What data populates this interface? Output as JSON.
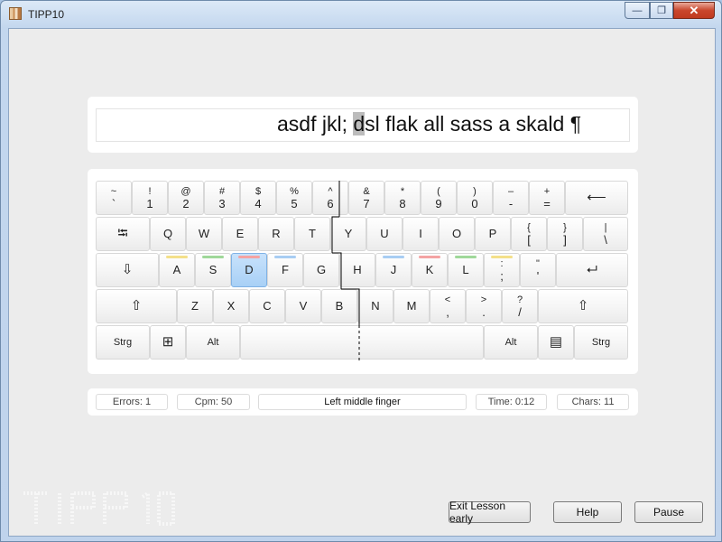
{
  "window": {
    "title": "TIPP10",
    "min_label": "—",
    "max_label": "❐",
    "close_label": "✕"
  },
  "text_line": {
    "before": "asdf jkl; ",
    "cursor": "d",
    "after": "sl flak all sass a skald ¶"
  },
  "keyboard": {
    "rows": [
      [
        {
          "top": "~",
          "bottom": "`"
        },
        {
          "top": "!",
          "bottom": "1"
        },
        {
          "top": "@",
          "bottom": "2"
        },
        {
          "top": "#",
          "bottom": "3"
        },
        {
          "top": "$",
          "bottom": "4"
        },
        {
          "top": "%",
          "bottom": "5"
        },
        {
          "top": "^",
          "bottom": "6"
        },
        {
          "top": "&",
          "bottom": "7"
        },
        {
          "top": "*",
          "bottom": "8"
        },
        {
          "top": "(",
          "bottom": "9"
        },
        {
          "top": ")",
          "bottom": "0"
        },
        {
          "top": "–",
          "bottom": "-"
        },
        {
          "top": "+",
          "bottom": "="
        },
        {
          "label": "⟵"
        }
      ],
      [
        {
          "label": "⭾"
        },
        {
          "label": "Q"
        },
        {
          "label": "W"
        },
        {
          "label": "E"
        },
        {
          "label": "R"
        },
        {
          "label": "T"
        },
        {
          "label": "Y"
        },
        {
          "label": "U"
        },
        {
          "label": "I"
        },
        {
          "label": "O"
        },
        {
          "label": "P"
        },
        {
          "top": "{",
          "bottom": "["
        },
        {
          "top": "}",
          "bottom": "]"
        },
        {
          "top": "|",
          "bottom": "\\"
        }
      ],
      [
        {
          "label": "⇩"
        },
        {
          "label": "A"
        },
        {
          "label": "S"
        },
        {
          "label": "D"
        },
        {
          "label": "F"
        },
        {
          "label": "G"
        },
        {
          "label": "H"
        },
        {
          "label": "J"
        },
        {
          "label": "K"
        },
        {
          "label": "L"
        },
        {
          "top": ":",
          "bottom": ";"
        },
        {
          "top": "\"",
          "bottom": "'"
        },
        {
          "label": "⮠"
        }
      ],
      [
        {
          "label": "⇧"
        },
        {
          "label": "Z"
        },
        {
          "label": "X"
        },
        {
          "label": "C"
        },
        {
          "label": "V"
        },
        {
          "label": "B"
        },
        {
          "label": "N"
        },
        {
          "label": "M"
        },
        {
          "top": "<",
          "bottom": ","
        },
        {
          "top": ">",
          "bottom": "."
        },
        {
          "top": "?",
          "bottom": "/"
        },
        {
          "label": "⇧"
        }
      ],
      [
        {
          "label": "Strg"
        },
        {
          "label": "⊞"
        },
        {
          "label": "Alt"
        },
        {
          "label": ""
        },
        {
          "label": "Alt"
        },
        {
          "label": "▤"
        },
        {
          "label": "Strg"
        }
      ]
    ],
    "active_key": "D",
    "finger_colors": {
      "pinky": "#f4e08a",
      "ring": "#9fd89a",
      "middle": "#f4a3a3",
      "index": "#a8cdf3"
    }
  },
  "status": {
    "errors": "Errors: 1",
    "cpm": "Cpm: 50",
    "finger": "Left middle finger",
    "time": "Time: 0:12",
    "chars": "Chars: 11"
  },
  "buttons": {
    "exit": "Exit Lesson early",
    "help": "Help",
    "pause": "Pause"
  },
  "logo_text": "TIPP10"
}
